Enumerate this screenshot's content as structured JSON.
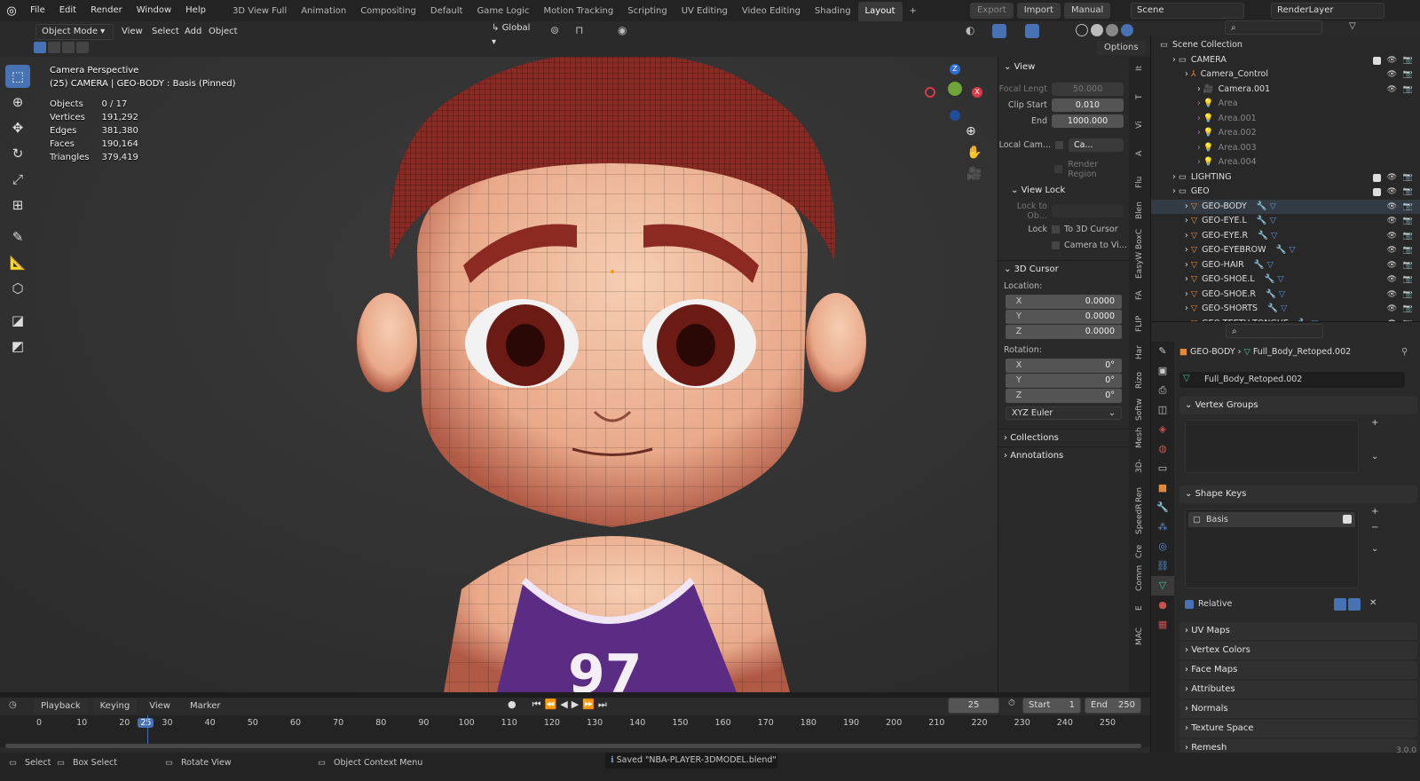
{
  "menus": [
    "File",
    "Edit",
    "Render",
    "Window",
    "Help"
  ],
  "workspaces": [
    "3D View Full",
    "Animation",
    "Compositing",
    "Default",
    "Game Logic",
    "Motion Tracking",
    "Scripting",
    "UV Editing",
    "Video Editing",
    "Shading",
    "Layout"
  ],
  "active_workspace": "Layout",
  "topright": {
    "export": "Export",
    "import": "Import",
    "manual": "Manual",
    "scene": "Scene",
    "render_layer": "RenderLayer"
  },
  "vp_header": {
    "mode": "Object Mode",
    "menus": [
      "View",
      "Select",
      "Add",
      "Object"
    ],
    "orientation": "Global",
    "options": "Options"
  },
  "info": {
    "line1": "Camera Perspective",
    "line2": "(25) CAMERA | GEO-BODY : Basis (Pinned)",
    "stats": [
      [
        "Objects",
        "0 / 17"
      ],
      [
        "Vertices",
        "191,292"
      ],
      [
        "Edges",
        "381,380"
      ],
      [
        "Faces",
        "190,164"
      ],
      [
        "Triangles",
        "379,419"
      ]
    ]
  },
  "npanel": {
    "view_title": "View",
    "focal_label": "Focal Lengt",
    "focal_value": "50.000",
    "clip_start_label": "Clip Start",
    "clip_start": "0.010",
    "end_label": "End",
    "clip_end": "1000.000",
    "local_cam": "Local Cam...",
    "local_cam_field": "Ca...",
    "render_region": "Render Region",
    "view_lock": "View Lock",
    "lock_to_obj": "Lock to Ob...",
    "lock": "Lock",
    "to_3d_cursor": "To 3D Cursor",
    "camera_to_view": "Camera to Vi...",
    "cursor_title": "3D Cursor",
    "location": "Location:",
    "loc": [
      [
        "X",
        "0.0000"
      ],
      [
        "Y",
        "0.0000"
      ],
      [
        "Z",
        "0.0000"
      ]
    ],
    "rotation": "Rotation:",
    "rot": [
      [
        "X",
        "0°"
      ],
      [
        "Y",
        "0°"
      ],
      [
        "Z",
        "0°"
      ]
    ],
    "euler": "XYZ Euler",
    "collections": "Collections",
    "annotations": "Annotations"
  },
  "vtabs": [
    "It",
    "T",
    "Vi",
    "A",
    "Flu",
    "Blen",
    "BoxC",
    "EasyW",
    "FA",
    "FLIP",
    "Har",
    "Rizo",
    "Softw",
    "Mesh",
    "3D-",
    "Ren",
    "SpeedR",
    "Cre",
    "Comm",
    "E",
    "MAC"
  ],
  "outliner": [
    {
      "name": "Scene Collection",
      "indent": 0,
      "kind": "coll"
    },
    {
      "name": "CAMERA",
      "indent": 1,
      "kind": "coll",
      "check": true
    },
    {
      "name": "Camera_Control",
      "indent": 2,
      "kind": "empty"
    },
    {
      "name": "Camera.001",
      "indent": 3,
      "kind": "cam",
      "eye": true
    },
    {
      "name": "Area",
      "indent": 3,
      "kind": "light",
      "dim": true
    },
    {
      "name": "Area.001",
      "indent": 3,
      "kind": "light",
      "dim": true
    },
    {
      "name": "Area.002",
      "indent": 3,
      "kind": "light",
      "dim": true
    },
    {
      "name": "Area.003",
      "indent": 3,
      "kind": "light",
      "dim": true
    },
    {
      "name": "Area.004",
      "indent": 3,
      "kind": "light",
      "dim": true
    },
    {
      "name": "LIGHTING",
      "indent": 1,
      "kind": "coll",
      "check": true
    },
    {
      "name": "GEO",
      "indent": 1,
      "kind": "coll",
      "check": true
    },
    {
      "name": "GEO-BODY",
      "indent": 2,
      "kind": "mesh",
      "hl": true
    },
    {
      "name": "GEO-EYE.L",
      "indent": 2,
      "kind": "mesh"
    },
    {
      "name": "GEO-EYE.R",
      "indent": 2,
      "kind": "mesh"
    },
    {
      "name": "GEO-EYEBROW",
      "indent": 2,
      "kind": "mesh"
    },
    {
      "name": "GEO-HAIR",
      "indent": 2,
      "kind": "mesh"
    },
    {
      "name": "GEO-SHOE.L",
      "indent": 2,
      "kind": "mesh"
    },
    {
      "name": "GEO-SHOE.R",
      "indent": 2,
      "kind": "mesh"
    },
    {
      "name": "GEO-SHORTS",
      "indent": 2,
      "kind": "mesh"
    },
    {
      "name": "GEO-TEETH-TONGUE",
      "indent": 2,
      "kind": "mesh"
    }
  ],
  "props": {
    "breadcrumb_obj": "GEO-BODY",
    "breadcrumb_mesh": "Full_Body_Retoped.002",
    "mesh_name": "Full_Body_Retoped.002",
    "vertex_groups": "Vertex Groups",
    "shape_keys": "Shape Keys",
    "shape_key_item": "Basis",
    "relative": "Relative",
    "sections": [
      "UV Maps",
      "Vertex Colors",
      "Face Maps",
      "Attributes",
      "Normals",
      "Texture Space",
      "Remesh"
    ]
  },
  "timeline": {
    "menus": [
      "Playback",
      "Keying",
      "View",
      "Marker"
    ],
    "current_frame": "25",
    "start_label": "Start",
    "start": "1",
    "end_label": "End",
    "end": "250",
    "ticks": [
      "0",
      "10",
      "20",
      "25",
      "30",
      "40",
      "50",
      "60",
      "70",
      "80",
      "90",
      "100",
      "110",
      "120",
      "130",
      "140",
      "150",
      "160",
      "170",
      "180",
      "190",
      "200",
      "210",
      "220",
      "230",
      "240",
      "250"
    ]
  },
  "status": {
    "select": "Select",
    "box_select": "Box Select",
    "rotate": "Rotate View",
    "context": "Object Context Menu",
    "saved": "Saved \"NBA-PLAYER-3DMODEL.blend\"",
    "version": "3.0.0"
  },
  "colors": {
    "accent": "#4772b3",
    "jersey": "#5b2c83",
    "hair": "#8a2a22",
    "skin": "#e9b59a"
  }
}
